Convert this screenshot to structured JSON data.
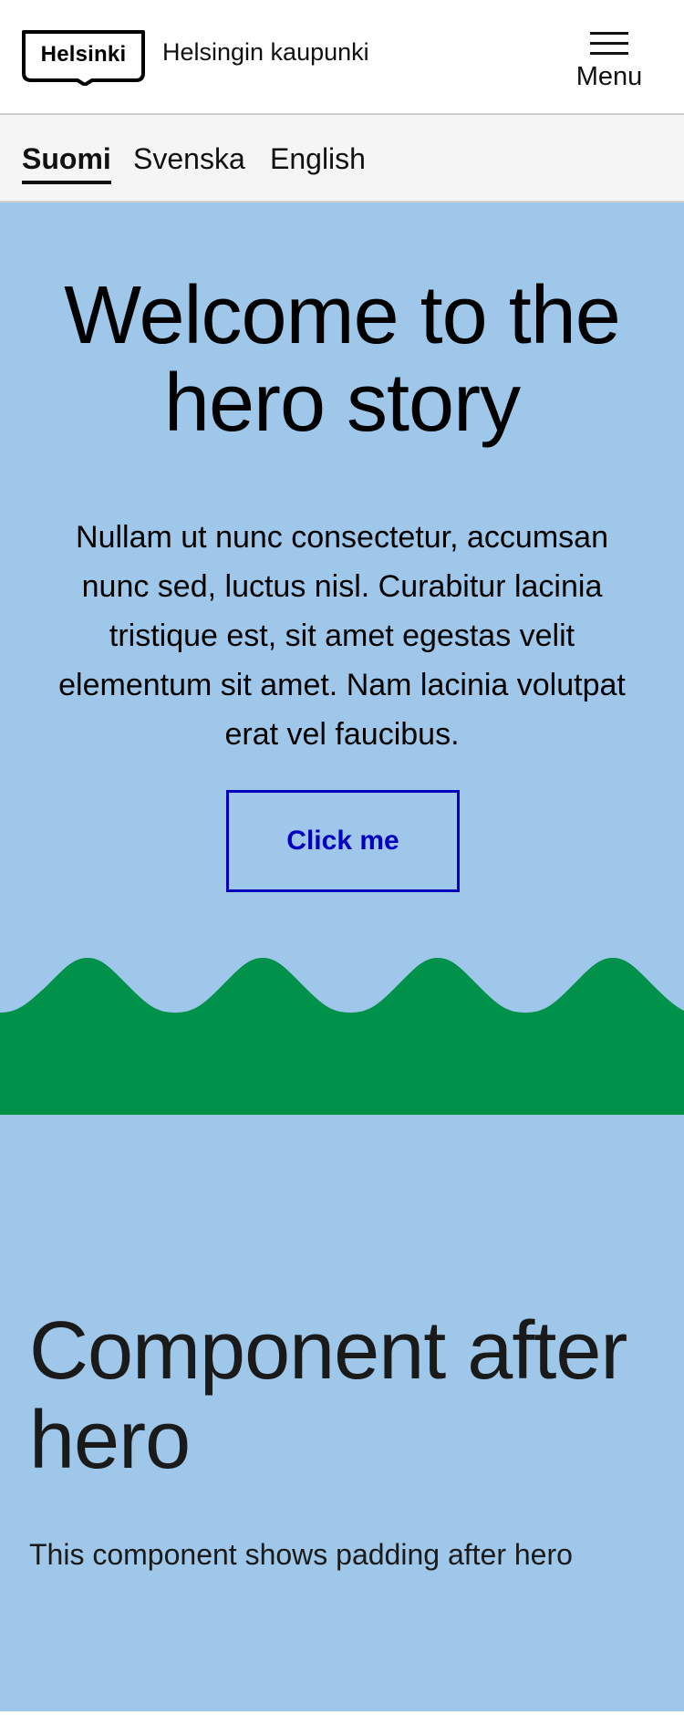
{
  "header": {
    "logo_text": "Helsinki",
    "site_name": "Helsingin kaupunki",
    "menu_label": "Menu"
  },
  "languages": [
    {
      "label": "Suomi",
      "active": true
    },
    {
      "label": "Svenska",
      "active": false
    },
    {
      "label": "English",
      "active": false
    }
  ],
  "hero": {
    "title": "Welcome to the hero story",
    "text": "Nullam ut nunc consectetur, accumsan nunc sed, luctus nisl. Curabitur lacinia tristique est, sit amet egestas velit elementum sit amet. Nam lacinia volutpat erat vel faucibus.",
    "button_label": "Click me"
  },
  "after_hero": {
    "title": "Component after hero",
    "text": "This component shows padding after hero"
  },
  "colors": {
    "hero_background": "#9fc7e9",
    "koros_green": "#00914a",
    "button_blue": "#0000bf"
  }
}
